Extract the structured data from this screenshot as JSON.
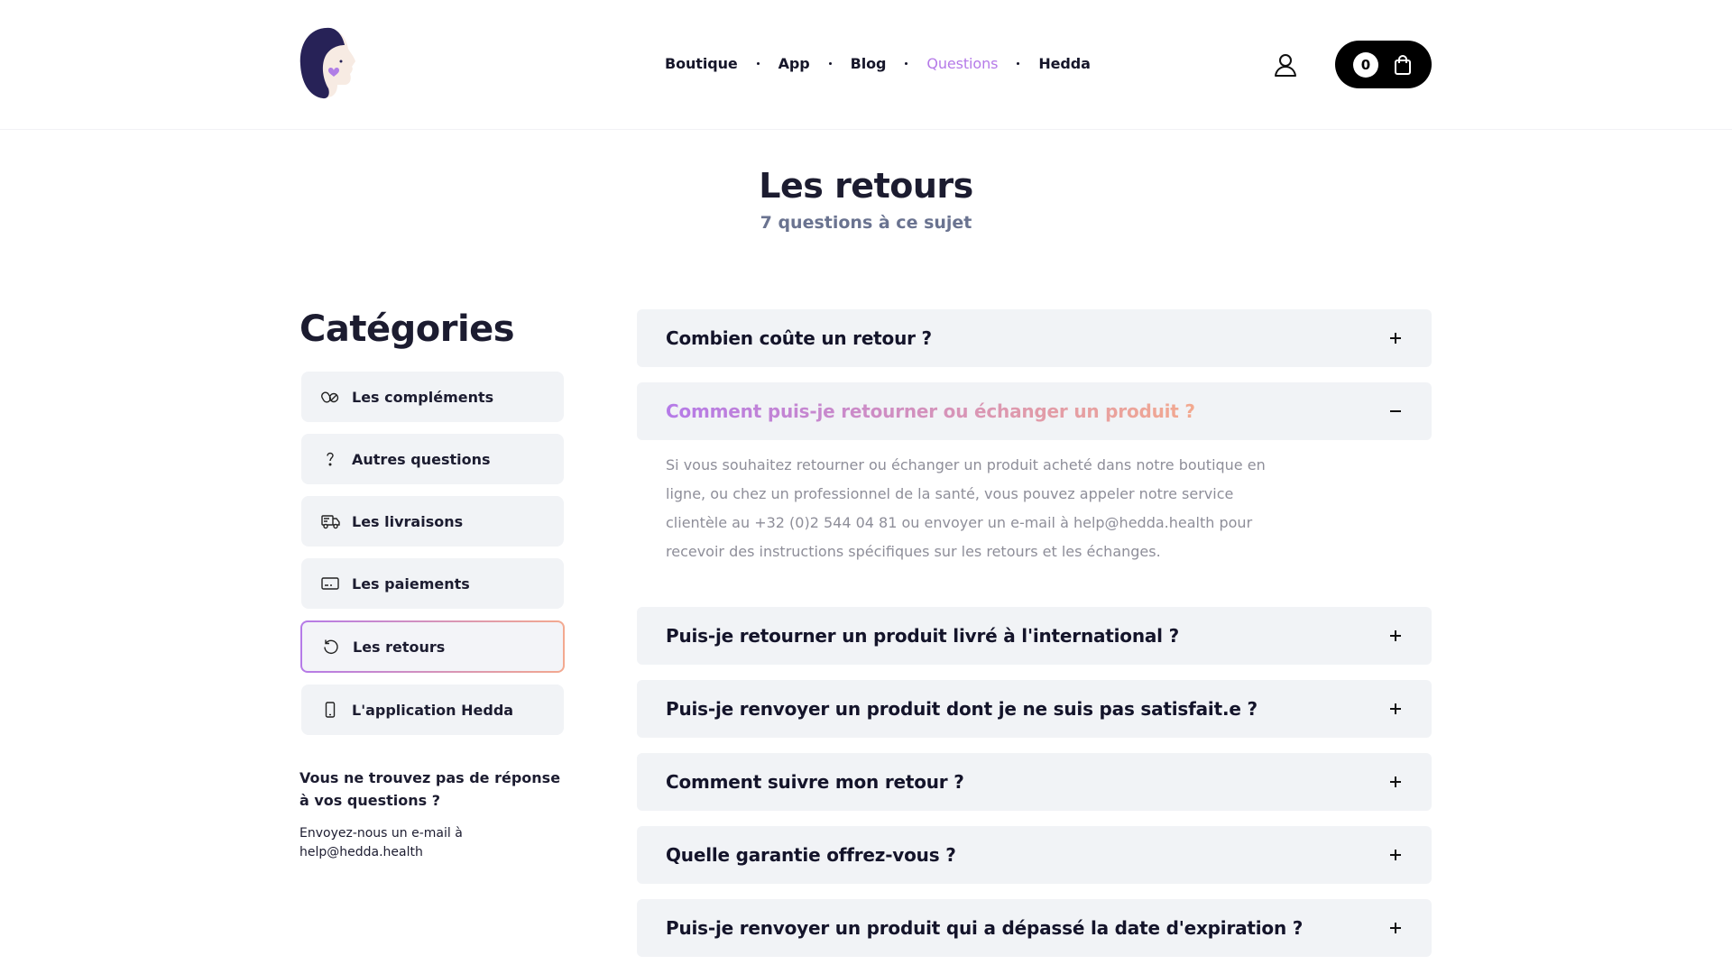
{
  "header": {
    "nav": [
      {
        "label": "Boutique",
        "active": false
      },
      {
        "label": "App",
        "active": false
      },
      {
        "label": "Blog",
        "active": false
      },
      {
        "label": "Questions",
        "active": true
      },
      {
        "label": "Hedda",
        "active": false
      }
    ],
    "cart_count": "0"
  },
  "page": {
    "title": "Les retours",
    "subtitle": "7 questions à ce sujet"
  },
  "sidebar": {
    "title": "Catégories",
    "categories": [
      {
        "label": "Les compléments",
        "icon": "pills-icon"
      },
      {
        "label": "Autres questions",
        "icon": "question-icon"
      },
      {
        "label": "Les livraisons",
        "icon": "truck-icon"
      },
      {
        "label": "Les paiements",
        "icon": "card-icon"
      },
      {
        "label": "Les retours",
        "icon": "return-icon",
        "active": true
      },
      {
        "label": "L'application Hedda",
        "icon": "phone-icon"
      }
    ],
    "help_title": "Vous ne trouvez pas de réponse à vos questions ?",
    "help_text": "Envoyez-nous un e-mail à help@hedda.health"
  },
  "faq": [
    {
      "question": "Combien coûte un retour ?",
      "open": false
    },
    {
      "question": "Comment puis-je retourner ou échanger un produit ?",
      "open": true,
      "answer": "Si vous souhaitez retourner ou échanger un produit acheté dans notre boutique en ligne, ou chez un professionnel de la santé, vous pouvez appeler notre service clientèle au +32 (0)2 544 04 81 ou envoyer un e-mail à help@hedda.health pour recevoir des instructions spécifiques sur les retours et les échanges."
    },
    {
      "question": "Puis-je retourner un produit livré à l'international ?",
      "open": false
    },
    {
      "question": "Puis-je renvoyer un produit dont je ne suis pas satisfait.e ?",
      "open": false
    },
    {
      "question": "Comment suivre mon retour ?",
      "open": false
    },
    {
      "question": "Quelle garantie offrez-vous ?",
      "open": false
    },
    {
      "question": "Puis-je renvoyer un produit qui a dépassé la date d'expiration ?",
      "open": false
    }
  ],
  "colors": {
    "accent_start": "#b57ae8",
    "accent_end": "#f3a98f",
    "card_bg": "#f1f3f6"
  }
}
